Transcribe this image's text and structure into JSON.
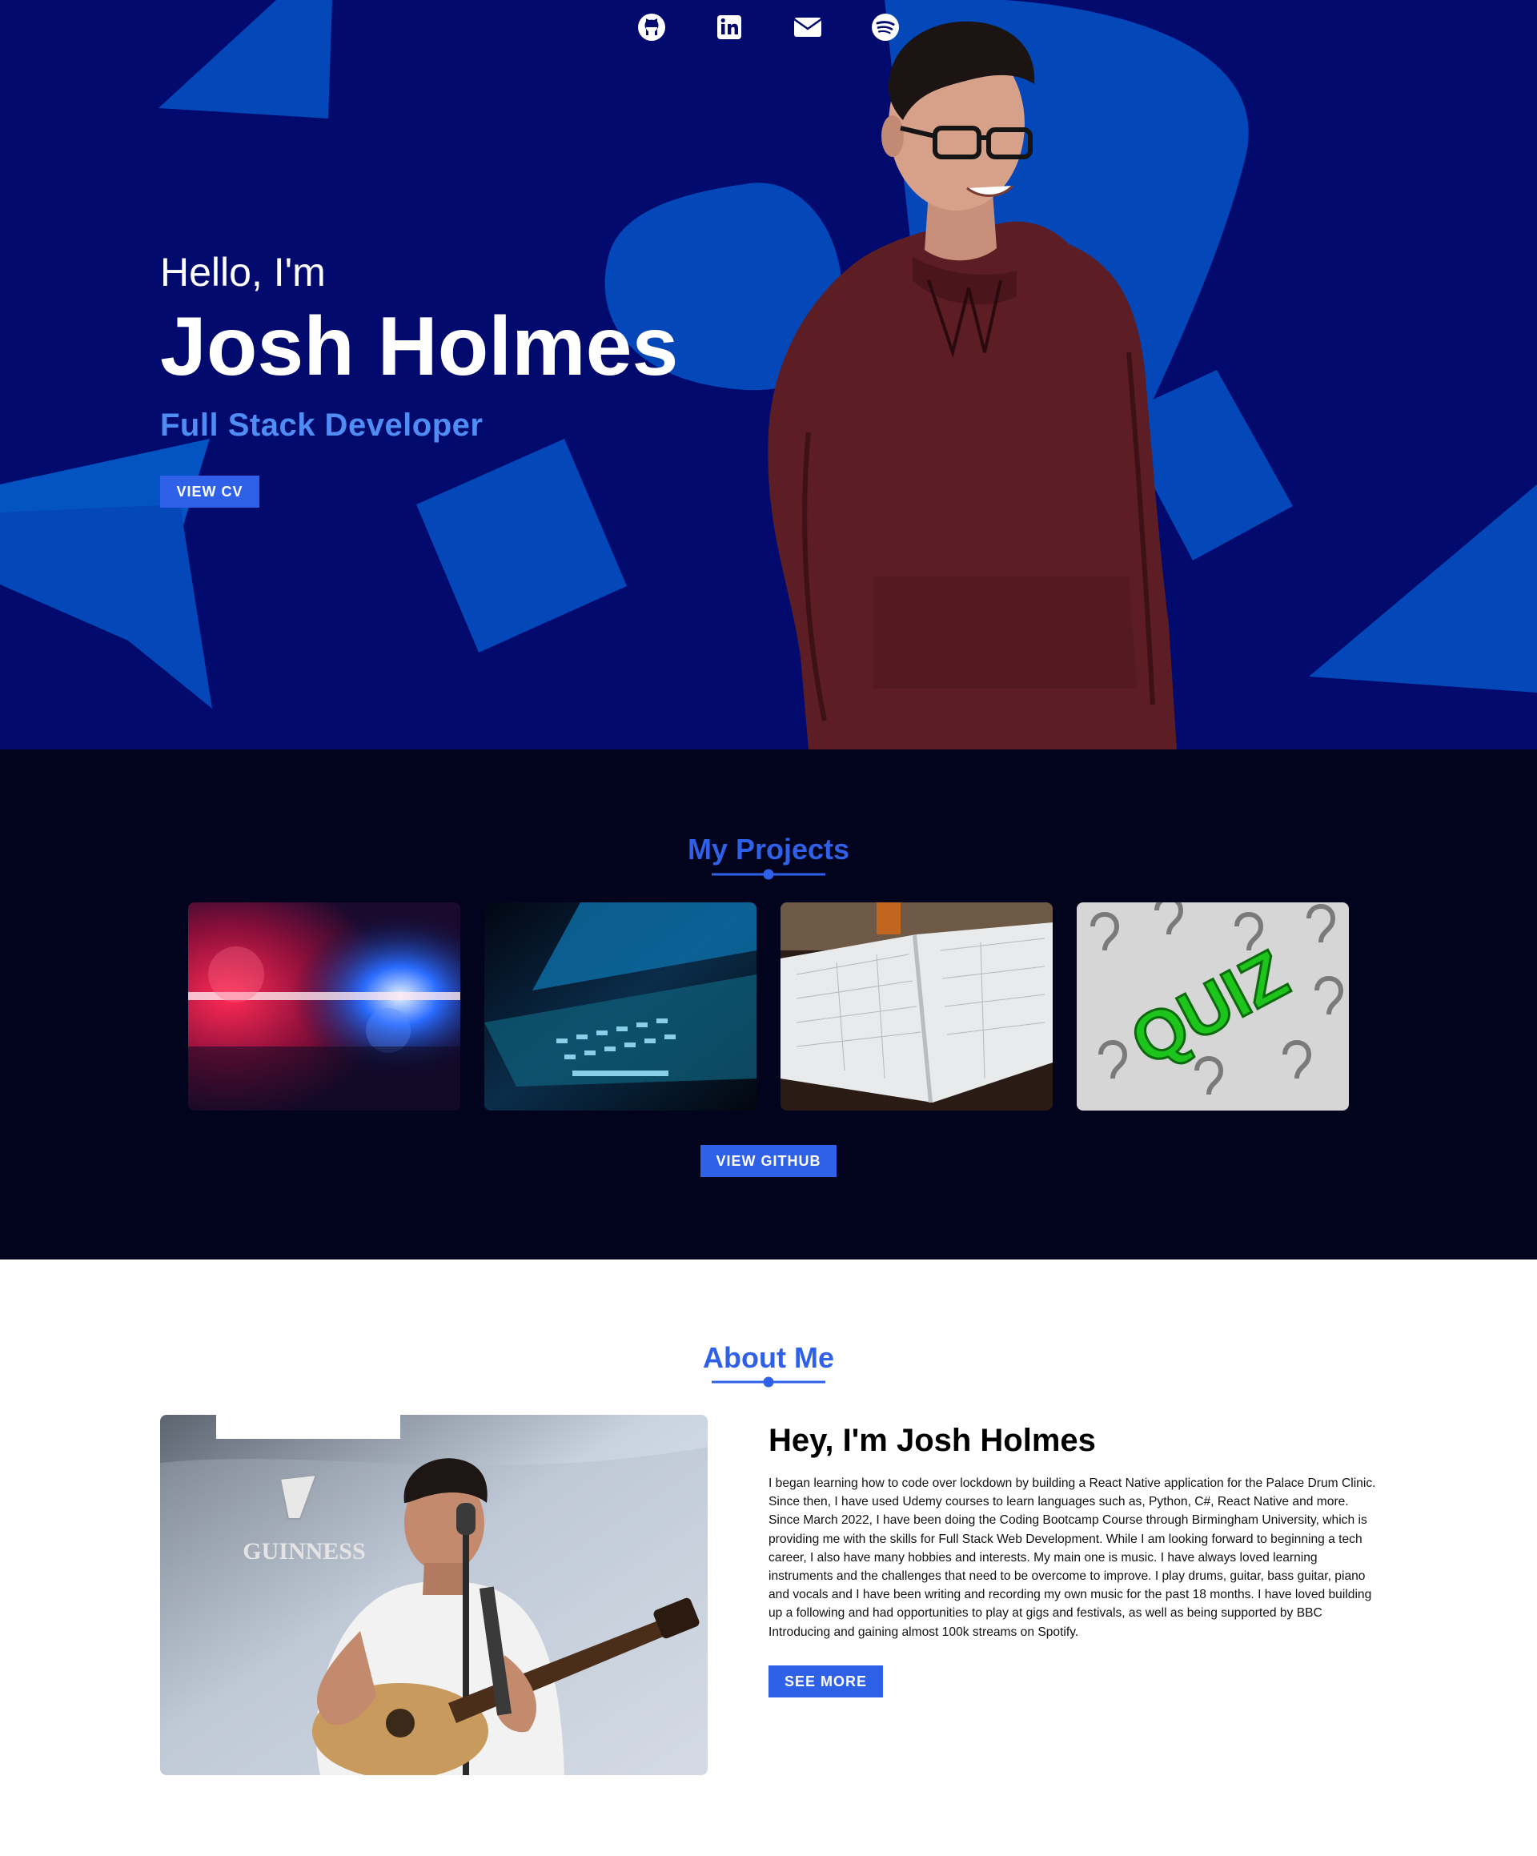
{
  "hero": {
    "greeting": "Hello, I'm",
    "name": "Josh Holmes",
    "role": "Full Stack Developer",
    "cv_button": "VIEW CV",
    "social_icons": [
      "github-icon",
      "linkedin-icon",
      "mail-icon",
      "spotify-icon"
    ]
  },
  "projects": {
    "title": "My Projects",
    "cards": [
      "police-lights-thumbnail",
      "laptop-keyboard-thumbnail",
      "planner-notebook-thumbnail",
      "quiz-thumbnail"
    ],
    "quiz_card_text": "QUIZ",
    "github_button": "VIEW GITHUB"
  },
  "about": {
    "title": "About Me",
    "photo_sign_text": "GUINNESS",
    "heading": "Hey, I'm Josh Holmes",
    "paragraph": "I began learning how to code over lockdown by building a React Native application for the Palace Drum Clinic. Since then, I have used Udemy courses to learn languages such as, Python, C#, React Native and more. Since March 2022, I have been doing the Coding Bootcamp Course through Birmingham University, which is providing me with the skills for Full Stack Web Development. While I am looking forward to beginning a tech career, I also have many hobbies and interests. My main one is music. I have always loved learning instruments and the challenges that need to be overcome to improve. I play drums, guitar, bass guitar, piano and vocals and I have been writing and recording my own music for the past 18 months. I have loved building up a following and had opportunities to play at gigs and festivals, as well as being supported by BBC Introducing and gaining almost 100k streams on Spotify.",
    "more_button": "SEE MORE"
  },
  "colors": {
    "hero_bg": "#020a6e",
    "hero_shapes": "#0447b8",
    "projects_bg": "#02041e",
    "accent": "#2f60e8",
    "role_text": "#4f8df5"
  }
}
